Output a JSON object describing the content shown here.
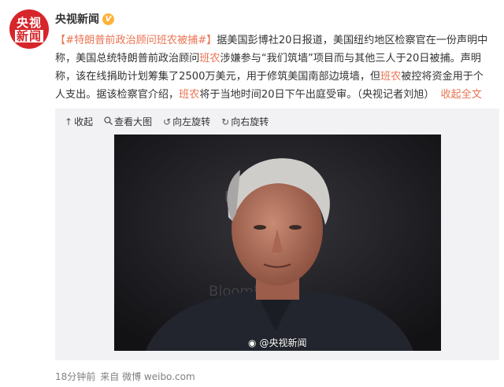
{
  "author": {
    "avatar_line1": "央视",
    "avatar_line2": "新闻",
    "name": "央视新闻",
    "badge": "V"
  },
  "post": {
    "topic": "【#特朗普前政治顾问班农被捕#】",
    "seg1": "据美国彭博社20日报道，美国纽约地区检察官在一份声明中称，美国总统特朗普前政治顾问",
    "hl1": "班农",
    "seg2": "涉嫌参与“我们筑墙”项目而与其他三人于20日被捕。声明称，该在线捐助计划筹集了2500万美元，用于修筑美国南部边境墙，但",
    "hl2": "班农",
    "seg3": "被控将资金用于个人支出。据该检察官介绍，",
    "hl3": "班农",
    "seg4": "将于当地时间20日下午出庭受审。（央视记者刘旭）",
    "collapse": "收起全文",
    "collapse_icon": "up-arrow-icon"
  },
  "media": {
    "tools": [
      {
        "icon": "up-arrow-icon",
        "label": "收起"
      },
      {
        "icon": "magnify-icon",
        "label": "查看大图"
      },
      {
        "icon": "rotate-left-icon",
        "label": "向左旋转"
      },
      {
        "icon": "rotate-right-icon",
        "label": "向右旋转"
      }
    ],
    "watermark": "@央视新闻"
  },
  "meta": {
    "time": "18分钟前",
    "source": "来自 微博 weibo.com"
  }
}
